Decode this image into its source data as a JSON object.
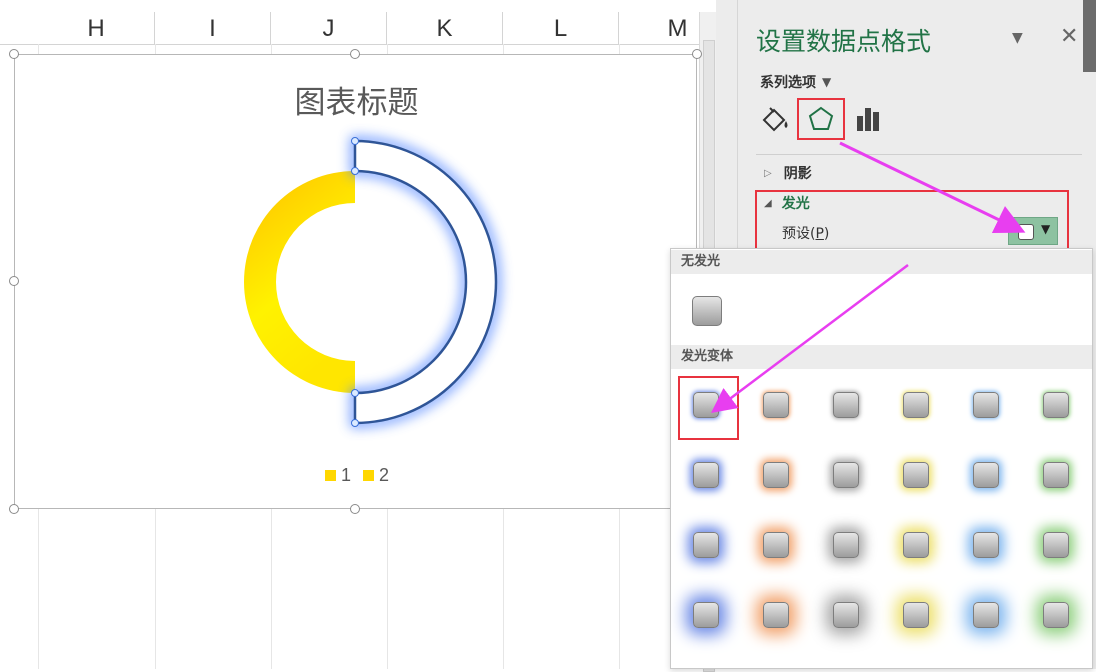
{
  "sheet": {
    "columns": [
      "H",
      "I",
      "J",
      "K",
      "L",
      "M"
    ]
  },
  "chart": {
    "title": "图表标题"
  },
  "chart_data": {
    "type": "pie",
    "subtype": "doughnut",
    "title": "图表标题",
    "series": [
      {
        "name": "1",
        "values": [
          50
        ],
        "color": "#ffd000",
        "note_gradient": [
          "#ffbf00",
          "#fff200"
        ]
      },
      {
        "name": "2",
        "values": [
          50
        ],
        "color": "#ffffff",
        "outline": "#2f5597",
        "glow": "#5b8cff",
        "selected_point": true
      }
    ],
    "legend": {
      "entries": [
        "1",
        "2"
      ],
      "placement": "bottom",
      "colors": [
        "#ffd700",
        "#ffd700"
      ]
    }
  },
  "pane": {
    "title": "设置数据点格式",
    "series_options": "系列选项",
    "tabs": [
      "fill-line-icon",
      "effects-icon",
      "series-options-icon"
    ],
    "sections": {
      "shadow": "阴影",
      "glow": "发光",
      "preset_label": "预设(",
      "preset_key": "P",
      "preset_close": ")"
    },
    "accent": "#217346"
  },
  "gallery": {
    "no_glow_header": "无发光",
    "variants_header": "发光变体",
    "variant_rows": [
      [
        "#6c8ae6",
        "#f2a26b",
        "#a8a8a8",
        "#ede06b",
        "#7eb6ef",
        "#8fd07f"
      ],
      [
        "#6c8ae6",
        "#f2a26b",
        "#a8a8a8",
        "#ede06b",
        "#7eb6ef",
        "#8fd07f"
      ],
      [
        "#6c8ae6",
        "#f2a26b",
        "#a8a8a8",
        "#ede06b",
        "#7eb6ef",
        "#8fd07f"
      ],
      [
        "#6c8ae6",
        "#f2a26b",
        "#a8a8a8",
        "#ede06b",
        "#7eb6ef",
        "#8fd07f"
      ]
    ],
    "glow_strength": [
      0.55,
      0.75,
      0.95,
      1.0
    ]
  },
  "annotations": {
    "highlight_color": "#e8333f",
    "arrow_color": "#e83ef0"
  }
}
